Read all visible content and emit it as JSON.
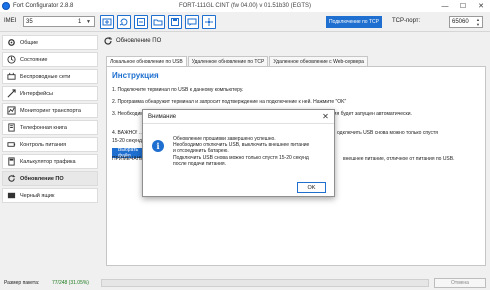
{
  "window": {
    "app_title": "Fort Configurator 2.8.8",
    "device_title": "FORT-111GL CINT (fw 04.00) v 01.51b30 (EGTS)",
    "controls": [
      "—",
      "☐",
      "✕"
    ]
  },
  "toolbar": {
    "imei_label": "IMEI",
    "imei_value": "35",
    "imei_index": "1",
    "connect_button": "Подключение по TCP",
    "tcp_port_label": "TCP-порт:",
    "tcp_port_value": "65060"
  },
  "sidebar": {
    "items": [
      {
        "label": "Общие",
        "icon": "gear-icon"
      },
      {
        "label": "Состояние",
        "icon": "state-icon"
      },
      {
        "label": "Беспроводные сети",
        "icon": "wireless-icon"
      },
      {
        "label": "Интерфейсы",
        "icon": "interfaces-icon"
      },
      {
        "label": "Мониторинг транспорта",
        "icon": "monitoring-icon"
      },
      {
        "label": "Телефонная книга",
        "icon": "phonebook-icon"
      },
      {
        "label": "Контроль питания",
        "icon": "power-icon"
      },
      {
        "label": "Калькулятор трафика",
        "icon": "calculator-icon"
      },
      {
        "label": "Обновление ПО",
        "icon": "update-icon",
        "active": true
      },
      {
        "label": "Черный ящик",
        "icon": "blackbox-icon"
      }
    ]
  },
  "main": {
    "page_title": "Обновление ПО",
    "tabs": [
      "Локальное обновление по USB",
      "Удаленное обновление по TCP",
      "Удаленное обновление с Web-сервера"
    ],
    "instructions_title": "Инструкция",
    "steps": [
      "1. Подключите терминал по USB к данному компьютеру.",
      "2. Программа обнаружит терминал и запросит подтверждение на подключение к ней. Нажмите \"OK\"",
      "3. Необходимо выбрать файл с расширением .bin/ .abin и нажать \"Открыть\", процесс обновления будет запущен автоматически."
    ],
    "select_button": "Выбрать файл",
    "step4_start": "4. ВАЖНО! ...",
    "step4_end": "одключить USB снова можно только спустя",
    "step4_line2": "15-20 секунд п...",
    "note_start": "ПРИМЕЧАНИЕ...",
    "note_end": "внешнее питание, отличное от питания по USB."
  },
  "dialog": {
    "title": "Внимание",
    "message": "Обновление прошивки завершено успешно.\nНеобходимо отключить USB, выключить внешнее питание\nи отсоединить батарею.\nПодключить USB снова можно только спустя 15-20 секунд\nпосле подачи питания.",
    "ok": "OK",
    "close": "✕"
  },
  "status": {
    "packet_size_label": "Размер пакета:",
    "packet_size_value": "77/248 (31.05%)",
    "progress_fraction": 0.0,
    "cancel": "Отмена"
  }
}
